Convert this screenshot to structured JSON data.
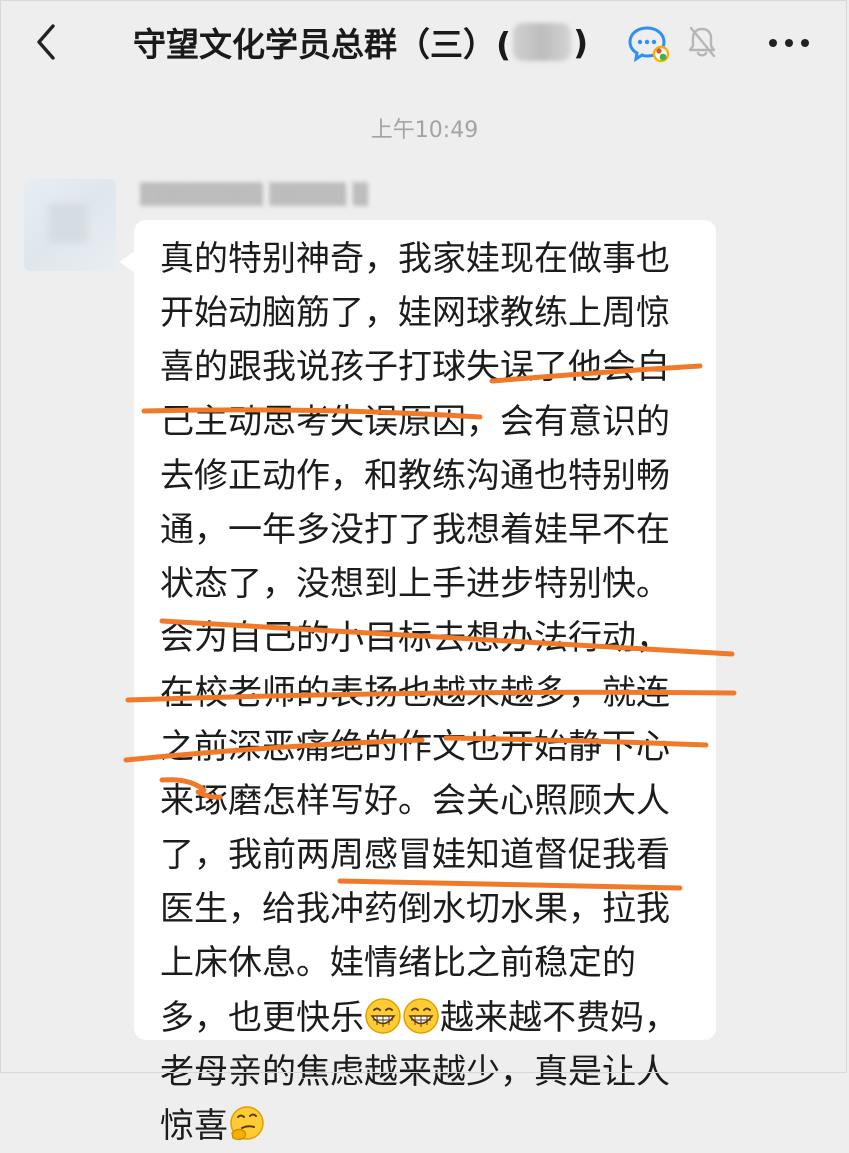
{
  "header": {
    "title_prefix": "守望文化学员总群（三）(",
    "title_suffix": ")",
    "back_icon": "chevron-left-icon",
    "chat_icon": "group-chat-icon",
    "mute_icon": "bell-muted-icon",
    "more_icon": "more-dots-icon"
  },
  "timestamp": "上午10:49",
  "message": {
    "lines": [
      "真的特别神奇，我家娃现在做事也",
      "开始动脑筋了，娃网球教练上周惊",
      "喜的跟我说孩子打球失误了他会自",
      "己主动思考失误原因，会有意识的",
      "去修正动作，和教练沟通也特别畅",
      "通，一年多没打了我想着娃早不在",
      "状态了，没想到上手进步特别快。",
      "会为自己的小目标去想办法行动，",
      "在校老师的表扬也越来越多，就连",
      "之前深恶痛绝的作文也开始静下心",
      "来琢磨怎样写好。会关心照顾大人",
      "了，我前两周感冒娃知道督促我看",
      "医生，给我冲药倒水切水果，拉我",
      "上床休息。娃情绪比之前稳定的",
      "多，也更快乐",
      "越来越不费妈，",
      "老母亲的焦虑越来越少，真是让人",
      "惊喜"
    ]
  },
  "colors": {
    "background": "#eeeeee",
    "bubble": "#ffffff",
    "highlight": "#f07a2a",
    "timestamp": "#a3a3a3"
  }
}
